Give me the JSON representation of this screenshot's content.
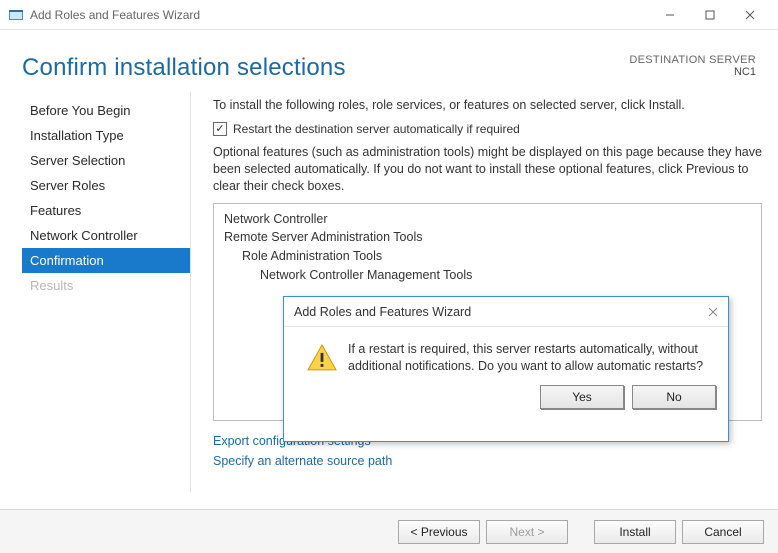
{
  "window": {
    "title": "Add Roles and Features Wizard"
  },
  "heading": "Confirm installation selections",
  "destination": {
    "label": "DESTINATION SERVER",
    "value": "NC1"
  },
  "sidebar": {
    "items": [
      {
        "label": "Before You Begin",
        "state": "normal"
      },
      {
        "label": "Installation Type",
        "state": "normal"
      },
      {
        "label": "Server Selection",
        "state": "normal"
      },
      {
        "label": "Server Roles",
        "state": "normal"
      },
      {
        "label": "Features",
        "state": "normal"
      },
      {
        "label": "Network Controller",
        "state": "normal"
      },
      {
        "label": "Confirmation",
        "state": "active"
      },
      {
        "label": "Results",
        "state": "disabled"
      }
    ]
  },
  "main": {
    "intro": "To install the following roles, role services, or features on selected server, click Install.",
    "checkbox_label": "Restart the destination server automatically if required",
    "checkbox_checked": true,
    "optional_text": "Optional features (such as administration tools) might be displayed on this page because they have been selected automatically. If you do not want to install these optional features, click Previous to clear their check boxes.",
    "feature_tree": {
      "l0a": "Network Controller",
      "l0b": "Remote Server Administration Tools",
      "l1a": "Role Administration Tools",
      "l2a": "Network Controller Management Tools"
    },
    "links": {
      "export": "Export configuration settings",
      "source": "Specify an alternate source path"
    }
  },
  "footer": {
    "previous": "< Previous",
    "next": "Next >",
    "install": "Install",
    "cancel": "Cancel"
  },
  "modal": {
    "title": "Add Roles and Features Wizard",
    "message": "If a restart is required, this server restarts automatically, without additional notifications. Do you want to allow automatic restarts?",
    "yes": "Yes",
    "no": "No"
  }
}
